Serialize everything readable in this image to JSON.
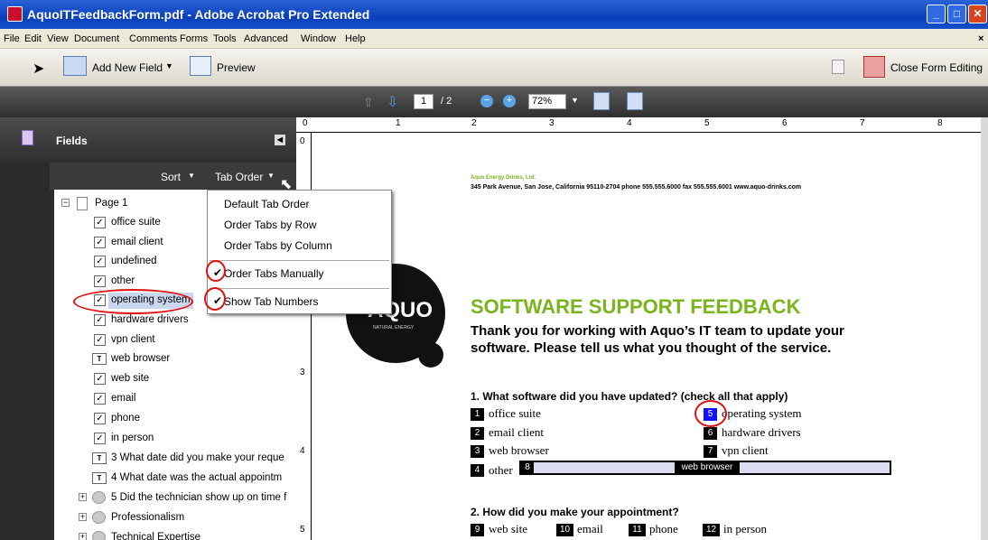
{
  "window": {
    "title": "AquoITFeedbackForm.pdf - Adobe Acrobat Pro Extended"
  },
  "menu": [
    "File",
    "Edit",
    "View",
    "Document",
    "Comments",
    "Forms",
    "Tools",
    "Advanced",
    "Window",
    "Help"
  ],
  "toolbar": {
    "add_field": "Add New Field",
    "preview": "Preview",
    "close_editing": "Close Form Editing"
  },
  "nav": {
    "page": "1",
    "total": "/ 2",
    "zoom": "72%"
  },
  "panel": {
    "title": "Fields",
    "sort": "Sort",
    "tab_order": "Tab Order"
  },
  "tree": {
    "page": "Page 1",
    "items": [
      "office suite",
      "email client",
      "undefined",
      "other",
      "operating system",
      "hardware drivers",
      "vpn client",
      "web browser",
      "web site",
      "email",
      "phone",
      "in person",
      "3 What date did you make your reque",
      "4 What date was the actual appointm",
      "5 Did the technician show up on time f",
      "Professionalism",
      "Technical Expertise"
    ]
  },
  "tab_menu": {
    "items": [
      "Default Tab Order",
      "Order Tabs by Row",
      "Order Tabs by Column",
      "Order Tabs Manually",
      "Show Tab Numbers"
    ],
    "checked": [
      "Order Tabs Manually",
      "Show Tab Numbers"
    ]
  },
  "ruler": {
    "top": [
      "0",
      "1",
      "2",
      "3",
      "4",
      "5",
      "6",
      "7",
      "8"
    ],
    "left": [
      "0",
      "3",
      "4",
      "5"
    ]
  },
  "document": {
    "company": "Aquo Energy Drinks, Ltd.",
    "address": "345 Park Avenue, San Jose, California 95110-2704  phone 555.555.6000  fax 555.555.6001  www.aquo-drinks.com",
    "logo_text": "AQUO",
    "logo_sub": "NATURAL ENERGY",
    "heading": "SOFTWARE SUPPORT FEEDBACK",
    "intro_1": "Thank you for working with Aquo’s IT team to update your",
    "intro_2": "software. Please tell us what you thought of the service.",
    "q1": "1. What software did you have updated? (check all that apply)",
    "q1_options": [
      {
        "n": "1",
        "label": "office suite"
      },
      {
        "n": "2",
        "label": "email client"
      },
      {
        "n": "3",
        "label": "web browser"
      },
      {
        "n": "4",
        "label": "other"
      },
      {
        "n": "5",
        "label": "operating system"
      },
      {
        "n": "6",
        "label": "hardware drivers"
      },
      {
        "n": "7",
        "label": "vpn client"
      }
    ],
    "other_field_num": "8",
    "other_field_value": "web browser",
    "q2": "2. How did you make your appointment?",
    "q2_options": [
      {
        "n": "9",
        "label": "web site"
      },
      {
        "n": "10",
        "label": "email"
      },
      {
        "n": "11",
        "label": "phone"
      },
      {
        "n": "12",
        "label": "in person"
      }
    ]
  },
  "colors": {
    "titlebar": "#0a3fb8",
    "heading": "#7ab51d",
    "highlight": "#e01010",
    "field_selected": "#0000ff"
  }
}
